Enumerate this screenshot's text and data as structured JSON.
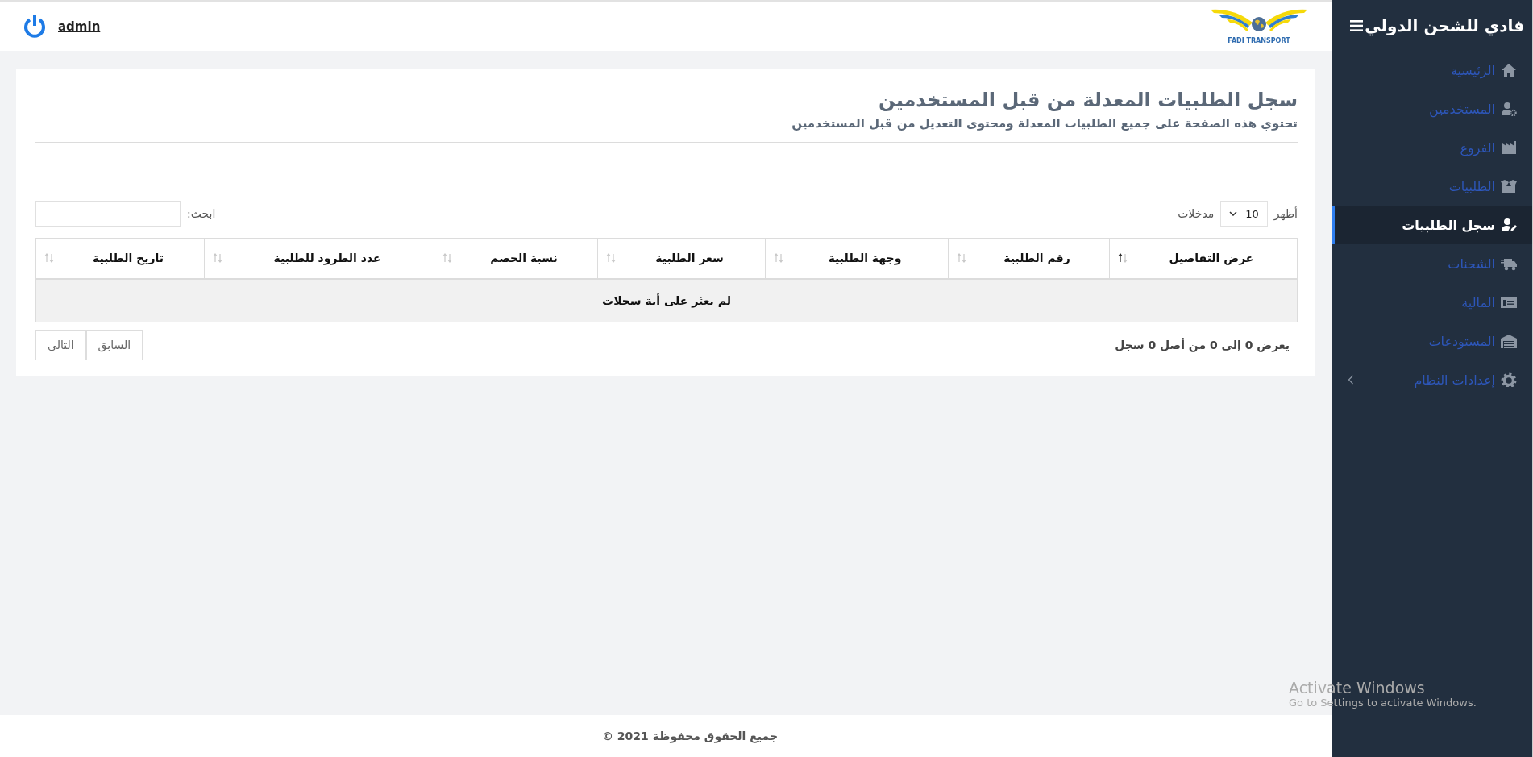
{
  "topbar": {
    "user": "admin",
    "logo_text": "FADI TRANSPORT"
  },
  "sidebar": {
    "title": "فادي للشحن الدولي",
    "items": [
      {
        "label": "الرئيسية",
        "selected": false,
        "kind": "link"
      },
      {
        "label": "المستخدمين",
        "selected": false,
        "kind": "link"
      },
      {
        "label": "الفروع",
        "selected": false,
        "kind": "link"
      },
      {
        "label": "الطلبيات",
        "selected": false,
        "kind": "link"
      },
      {
        "label": "سجل الطلبيات",
        "selected": true,
        "kind": "link"
      },
      {
        "label": "الشحنات",
        "selected": false,
        "kind": "link"
      },
      {
        "label": "المالية",
        "selected": false,
        "kind": "link"
      },
      {
        "label": "المستودعات",
        "selected": false,
        "kind": "link"
      },
      {
        "label": "إعدادات النظام",
        "selected": false,
        "kind": "submenu"
      }
    ]
  },
  "page": {
    "title": "سجل الطلبيات المعدلة من قبل المستخدمين",
    "subtitle": "تحتوي هذه الصفحة على جميع الطلبيات المعدلة ومحتوى التعديل من قبل المستخدمين"
  },
  "length": {
    "before": "أظهر",
    "value": "10",
    "after": "مدخلات"
  },
  "search": {
    "label": "ابحث:"
  },
  "table": {
    "columns": [
      {
        "label": "عرض التفاصيل",
        "sorted_ascending": true
      },
      {
        "label": "رقم الطلبية",
        "sorted_ascending": false
      },
      {
        "label": "وجهة الطلبية",
        "sorted_ascending": false
      },
      {
        "label": "سعر الطلبية",
        "sorted_ascending": false
      },
      {
        "label": "نسبة الخصم",
        "sorted_ascending": false
      },
      {
        "label": "عدد الطرود للطلبية",
        "sorted_ascending": false
      },
      {
        "label": "تاريخ الطلبية",
        "sorted_ascending": false
      }
    ],
    "empty": "لم يعثر على أية سجلات"
  },
  "info": "يعرض 0 إلى 0 من أصل 0 سجل",
  "pagination": [
    {
      "label": "السابق",
      "disabled": true
    },
    {
      "label": "التالي",
      "disabled": true
    }
  ],
  "footer": "جميع الحقوق محفوظة 2021 ©",
  "os_notice": {
    "title": "Activate Windows",
    "text": "Go to Settings to activate Windows."
  }
}
